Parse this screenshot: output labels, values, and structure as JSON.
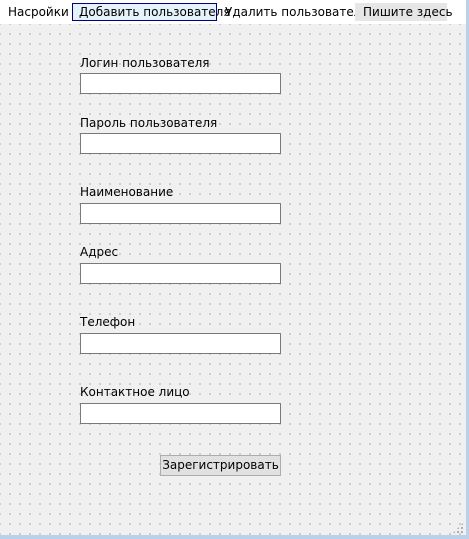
{
  "menu": {
    "settings_label": "Насройки",
    "add_user_label": "Добавить пользователя",
    "delete_user_label": "Удалить пользователя",
    "type_here_label": "Пишите здесь"
  },
  "form": {
    "fields": [
      {
        "label": "Логин пользователя",
        "value": ""
      },
      {
        "label": "Пароль пользователя",
        "value": ""
      },
      {
        "label": "Наименование",
        "value": ""
      },
      {
        "label": "Адрес",
        "value": ""
      },
      {
        "label": "Телефон",
        "value": ""
      },
      {
        "label": "Контактное лицо",
        "value": ""
      }
    ],
    "register_label": "Зарегистрировать"
  },
  "icons": {
    "resize_grip": "resize-grip-icon"
  }
}
